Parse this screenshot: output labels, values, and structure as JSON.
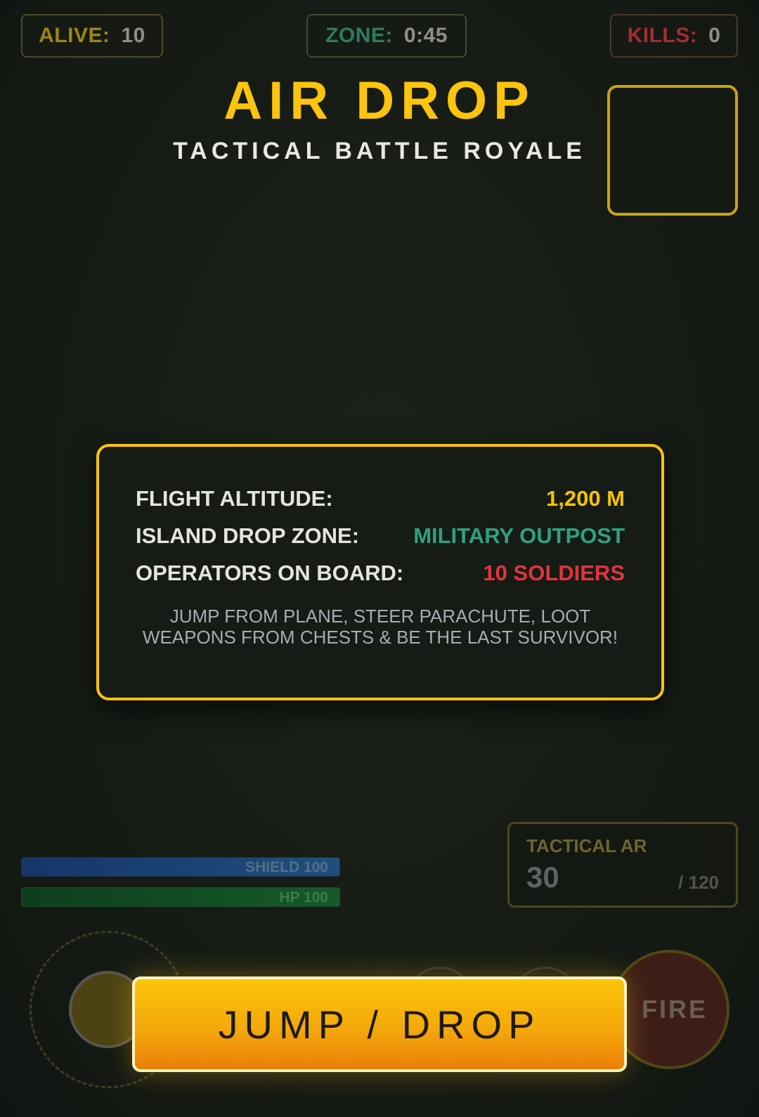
{
  "hud": {
    "alive": {
      "label": "ALIVE:",
      "value": "10"
    },
    "zone": {
      "label": "ZONE:",
      "value": "0:45"
    },
    "kills": {
      "label": "KILLS:",
      "value": "0"
    }
  },
  "title": "AIR DROP",
  "subtitle": "TACTICAL BATTLE ROYALE",
  "info": {
    "rows": [
      {
        "label": "FLIGHT ALTITUDE:",
        "value": "1,200 M"
      },
      {
        "label": "ISLAND DROP ZONE:",
        "value": "MILITARY OUTPOST"
      },
      {
        "label": "OPERATORS ON BOARD:",
        "value": "10 SOLDIERS"
      }
    ],
    "description": "JUMP FROM PLANE, STEER PARACHUTE, LOOT WEAPONS FROM CHESTS & BE THE LAST SURVIVOR!"
  },
  "weapon": {
    "name": "TACTICAL AR",
    "ammo": "30",
    "reserve": "/ 120"
  },
  "status": {
    "shield": {
      "label": "SHIELD 100",
      "percent": 100
    },
    "hp": {
      "label": "HP 100",
      "percent": 100
    }
  },
  "controls": {
    "fire_label": "FIRE",
    "jump_label": "JUMP / DROP"
  },
  "colors": {
    "accent": "#fcc40c",
    "zone": "#2fa083",
    "danger": "#e0353f"
  }
}
